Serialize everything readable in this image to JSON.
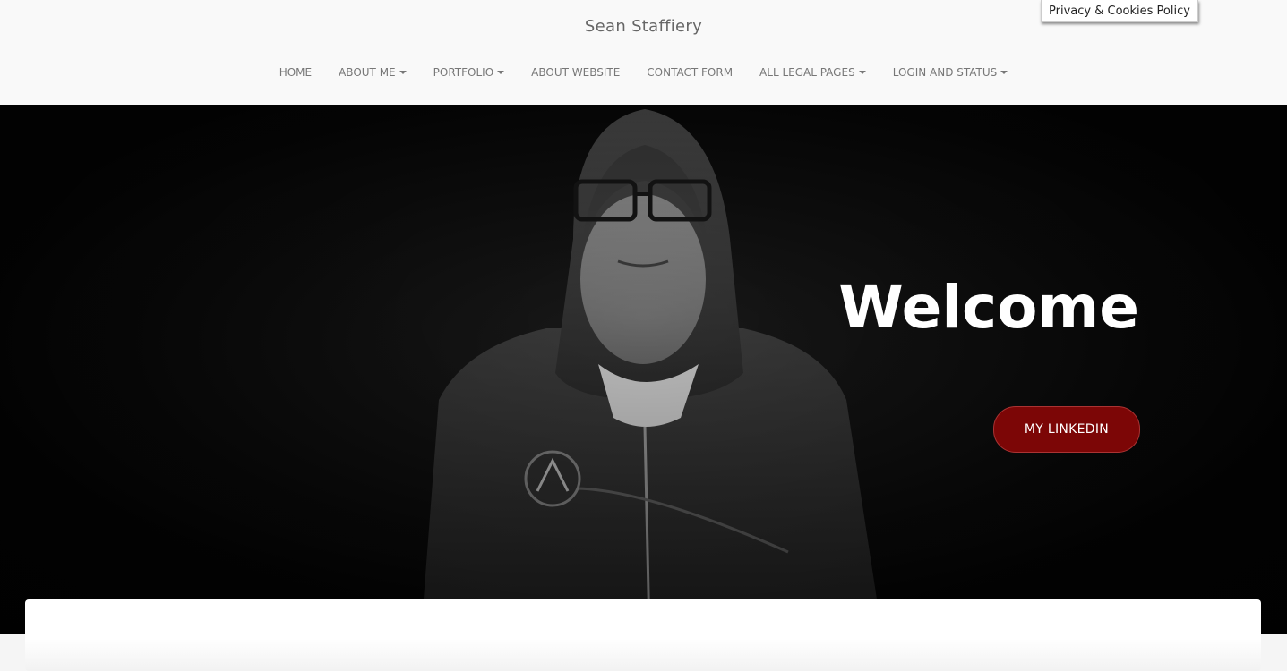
{
  "site": {
    "title": "Sean Staffiery"
  },
  "nav": {
    "items": [
      {
        "label": "Home",
        "has_dropdown": false
      },
      {
        "label": "About Me",
        "has_dropdown": true
      },
      {
        "label": "Portfolio",
        "has_dropdown": true
      },
      {
        "label": "About Website",
        "has_dropdown": false
      },
      {
        "label": "Contact Form",
        "has_dropdown": false
      },
      {
        "label": "All Legal Pages",
        "has_dropdown": true
      },
      {
        "label": "Login and Status",
        "has_dropdown": true
      }
    ]
  },
  "privacy": {
    "label": "Privacy & Cookies Policy"
  },
  "hero": {
    "heading": "Welcome",
    "button_label": "My LinkedIn",
    "button_color": "#7c0606"
  },
  "colors": {
    "header_bg": "#f9f9f9",
    "nav_text": "#777777",
    "hero_bg": "#060606"
  }
}
